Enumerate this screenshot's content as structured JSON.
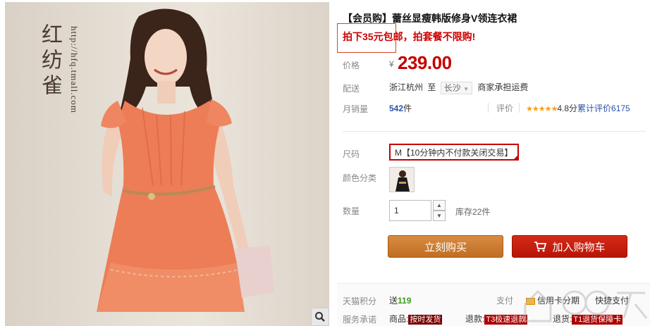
{
  "gallery": {
    "brand_name": "红纺雀",
    "brand_url": "http://hfq.tmall.com"
  },
  "product": {
    "title": "【会员购】蕾丝显瘦韩版修身V领连衣裙",
    "promo": "拍下35元包邮，拍套餐不限购!"
  },
  "price": {
    "label": "价格",
    "currency": "¥",
    "value": "239.00"
  },
  "delivery": {
    "label": "配送",
    "from": "浙江杭州",
    "to_word": "至",
    "city": "长沙",
    "shipping_note": "商家承担运费"
  },
  "sales": {
    "label": "月销量",
    "count": "542",
    "unit": "件",
    "rating_label": "评价",
    "stars": "★★★★★",
    "score": "4.8分",
    "review_text": "累计评价",
    "review_count": "6175"
  },
  "size": {
    "label": "尺码",
    "selected": "M【10分钟内不付款关闭交易】"
  },
  "color": {
    "label": "颜色分类"
  },
  "quantity": {
    "label": "数量",
    "value": "1",
    "stock": "库存22件"
  },
  "actions": {
    "buy_now": "立刻购买",
    "add_to_cart": "加入购物车"
  },
  "points": {
    "label": "天猫积分",
    "prefix": "送",
    "value": "119",
    "pay_label": "支付",
    "credit_label": "信用卡分期",
    "quick_pay": "快捷支付"
  },
  "service": {
    "label": "服务承诺",
    "goods_label": "商品:",
    "goods_tag": "按时发货",
    "refund_label": "退款:",
    "refund_tag": "T3极速退款",
    "return_label": "退货:",
    "return_tag": "T1退货保障卡"
  },
  "colors": {
    "price_red": "#c40000",
    "buy_orange": "#c8772e",
    "cart_red": "#c41f0c",
    "review_blue": "#2953a6"
  }
}
